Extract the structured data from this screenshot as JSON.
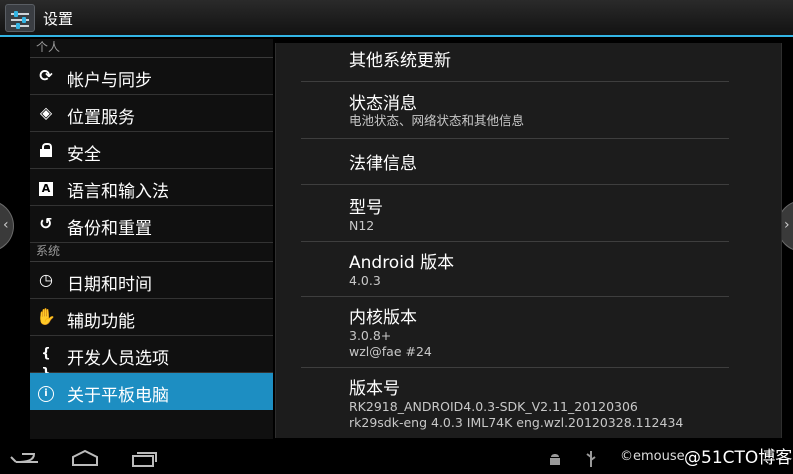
{
  "action_bar": {
    "title": "设置",
    "icon": "settings-sliders-icon"
  },
  "sections": [
    {
      "header": "个人",
      "items": [
        {
          "label": "帐户与同步",
          "icon": "sync-icon",
          "glyph": "⟳"
        },
        {
          "label": "位置服务",
          "icon": "location-icon",
          "glyph": "◈"
        },
        {
          "label": "安全",
          "icon": "lock-icon",
          "glyph": ""
        },
        {
          "label": "语言和输入法",
          "icon": "language-icon",
          "glyph": "A"
        },
        {
          "label": "备份和重置",
          "icon": "backup-icon",
          "glyph": "↺"
        }
      ]
    },
    {
      "header": "系统",
      "items": [
        {
          "label": "日期和时间",
          "icon": "clock-icon",
          "glyph": "◷"
        },
        {
          "label": "辅助功能",
          "icon": "hand-icon",
          "glyph": "✋"
        },
        {
          "label": "开发人员选项",
          "icon": "braces-icon",
          "glyph": "{ }"
        },
        {
          "label": "关于平板电脑",
          "icon": "info-icon",
          "glyph": "i",
          "selected": true
        }
      ]
    }
  ],
  "detail": {
    "items": [
      {
        "title": "其他系统更新",
        "summary": []
      },
      {
        "title": "状态消息",
        "summary": [
          "电池状态、网络状态和其他信息"
        ]
      },
      {
        "title": "法律信息",
        "summary": []
      },
      {
        "title": "型号",
        "summary": [
          "N12"
        ]
      },
      {
        "title": "Android 版本",
        "summary": [
          "4.0.3"
        ]
      },
      {
        "title": "内核版本",
        "summary": [
          "3.0.8+",
          "wzl@fae #24"
        ]
      },
      {
        "title": "版本号",
        "summary": [
          "RK2918_ANDROID4.0.3-SDK_V2.11_20120306",
          "rk29sdk-eng 4.0.3 IML74K eng.wzl.20120328.112434"
        ]
      }
    ]
  },
  "system_bar": {
    "buttons": [
      "back-icon",
      "home-icon",
      "recent-apps-icon"
    ],
    "status_icons": [
      "android-debug-icon",
      "usb-icon"
    ],
    "watermark_small": "©emouse",
    "watermark": "@51CTO博客"
  },
  "colors": {
    "accent": "#33b5e5",
    "selected": "#1d8ec2"
  }
}
